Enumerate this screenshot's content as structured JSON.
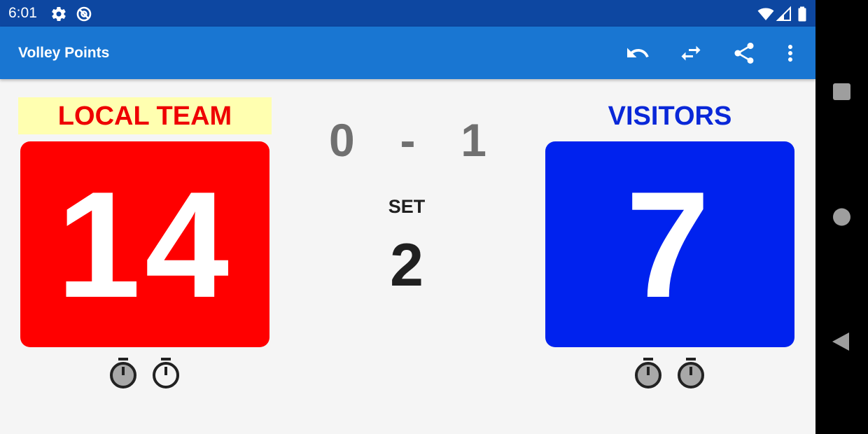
{
  "status_bar": {
    "time": "6:01",
    "icons": [
      "gear-icon",
      "do-not-disturb-icon",
      "wifi-icon",
      "signal-icon",
      "battery-icon"
    ]
  },
  "app_bar": {
    "title": "Volley Points",
    "actions": [
      "undo-icon",
      "swap-teams-icon",
      "share-icon",
      "more-vert-icon"
    ]
  },
  "local_team": {
    "name": "LOCAL TEAM",
    "points": "14",
    "color": "#ff0000",
    "name_color": "#ee0000",
    "name_background": "#ffffb0",
    "timeouts_shown": 2
  },
  "visitor_team": {
    "name": "VISITORS",
    "points": "7",
    "color": "#0022ee",
    "name_color": "#0a28d8",
    "timeouts_shown": 2
  },
  "sets": {
    "local": "0",
    "separator": "-",
    "visitor": "1",
    "label": "SET",
    "current": "2"
  },
  "colors": {
    "status_bar": "#0d47a1",
    "app_bar": "#1976d2",
    "background": "#f5f5f5"
  },
  "nav_bar": [
    "recents-square-icon",
    "home-circle-icon",
    "back-triangle-icon"
  ]
}
